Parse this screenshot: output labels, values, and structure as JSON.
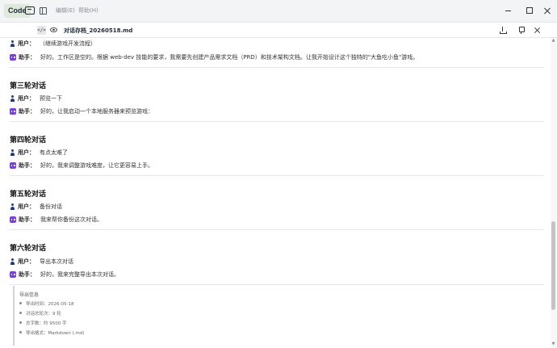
{
  "titlebar": {
    "app_label": "Code",
    "menus": [
      "编辑(E)",
      "帮助(H)"
    ]
  },
  "icons": {
    "chat": "chat-window-icon",
    "sidebar": "sidebar-toggle-icon",
    "code_view": "code-view-icon",
    "preview": "eye-icon",
    "download": "download-icon",
    "pin": "pin-icon",
    "close": "close-icon"
  },
  "document": {
    "filename": "对话存档_20260518.md"
  },
  "conversation": {
    "intro": [
      {
        "role": "用户：",
        "text": "（继续游戏开发流程）"
      },
      {
        "role": "助手：",
        "text": "好的。工作区是空的。根据 web-dev 技能的要求，我需要先创建产品需求文档（PRD）和技术架构文档。让我开始设计这个独特的\"大鱼吃小鱼\"游戏。"
      }
    ],
    "rounds": [
      {
        "title": "第三轮对话",
        "user": {
          "role": "用户：",
          "text": "预览一下"
        },
        "assistant": {
          "role": "助手：",
          "text": "好的，让我启动一个本地服务器来预览游戏："
        }
      },
      {
        "title": "第四轮对话",
        "user": {
          "role": "用户：",
          "text": "有点太难了"
        },
        "assistant": {
          "role": "助手：",
          "text": "好的，我来调整游戏难度，让它更容易上手。"
        }
      },
      {
        "title": "第五轮对话",
        "user": {
          "role": "用户：",
          "text": "备份对话"
        },
        "assistant": {
          "role": "助手：",
          "text": "我来帮你备份这次对话。"
        }
      },
      {
        "title": "第六轮对话",
        "user": {
          "role": "用户：",
          "text": "导出本次对话"
        },
        "assistant": {
          "role": "助手：",
          "text": "好的，我来完整导出本次对话。"
        }
      }
    ]
  },
  "summary": {
    "title": "导出信息",
    "items": [
      "导出时间：2026-05-18",
      "对话总轮次：9 轮",
      "总字数：约 9500 字",
      "导出格式：Markdown (.md)"
    ]
  }
}
